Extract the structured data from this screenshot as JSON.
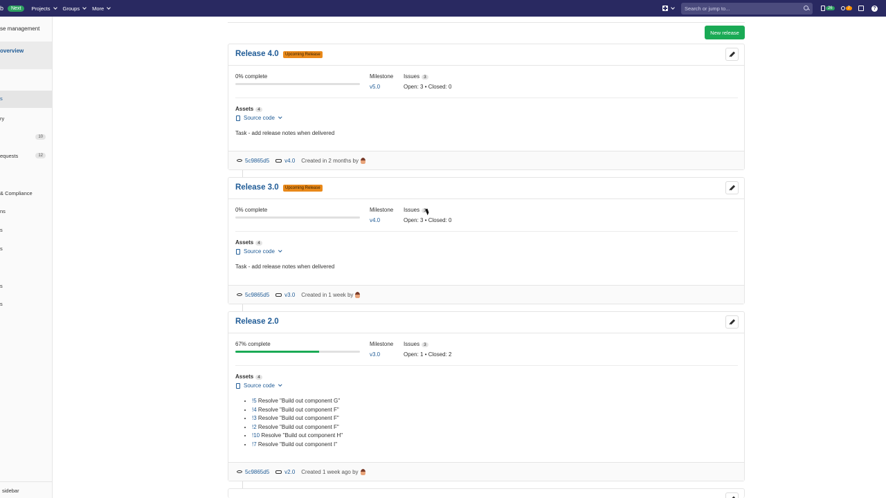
{
  "navbar": {
    "logo_fragment": "b",
    "next_badge": "Next",
    "menu": [
      "Projects",
      "Groups",
      "More"
    ],
    "search_placeholder": "Search or jump to...",
    "issues_count": "26",
    "mr_count": "7",
    "colors": {
      "bg": "#292961",
      "green": "#2da160",
      "orange": "#fc9403"
    }
  },
  "sidebar": {
    "title": "se management",
    "active_subitem": "overview",
    "items": [
      {
        "label": "s"
      },
      {
        "label": "ry"
      },
      {
        "label": "",
        "count": "10"
      },
      {
        "label": "equests",
        "count": "12"
      },
      {
        "label": "& Compliance"
      },
      {
        "label": "ns"
      },
      {
        "label": "s"
      },
      {
        "label": "s"
      },
      {
        "label": "s"
      },
      {
        "label": "s"
      }
    ],
    "collapse": "sidebar"
  },
  "toolbar": {
    "new_release_label": "New release"
  },
  "labels": {
    "milestone": "Milestone",
    "issues": "Issues",
    "assets": "Assets",
    "source_code": "Source code",
    "upcoming": "Upcoming Release"
  },
  "releases": [
    {
      "title": "Release 4.0",
      "upcoming": true,
      "pct_text": "0% complete",
      "progress": 0,
      "milestone": "v5.0",
      "issues_count": "3",
      "open_closed": "Open: 3 • Closed: 0",
      "assets_count": "4",
      "notes": "Task - add release notes when delivered",
      "commit": "5c9865d5",
      "tag": "v4.0",
      "created": "Created in 2 months by"
    },
    {
      "title": "Release 3.0",
      "upcoming": true,
      "pct_text": "0% complete",
      "progress": 0,
      "milestone": "v4.0",
      "issues_count": "3",
      "open_closed": "Open: 3 • Closed: 0",
      "assets_count": "4",
      "notes": "Task - add release notes when delivered",
      "commit": "5c9865d5",
      "tag": "v3.0",
      "created": "Created in 1 week by"
    },
    {
      "title": "Release 2.0",
      "upcoming": false,
      "pct_text": "67% complete",
      "progress": 67,
      "milestone": "v3.0",
      "issues_count": "3",
      "open_closed": "Open: 1 • Closed: 2",
      "assets_count": "4",
      "merge_requests": [
        {
          "ref": "!5",
          "text": " Resolve \"Build out component G\""
        },
        {
          "ref": "!4",
          "text": " Resolve \"Build out component F\""
        },
        {
          "ref": "!3",
          "text": " Resolve \"Build out component F\""
        },
        {
          "ref": "!2",
          "text": " Resolve \"Build out component F\""
        },
        {
          "ref": "!10",
          "text": " Resolve \"Build out component H\""
        },
        {
          "ref": "!7",
          "text": " Resolve \"Build out component I\""
        }
      ],
      "commit": "5c9865d5",
      "tag": "v2.0",
      "created": "Created 1 week ago by"
    }
  ]
}
